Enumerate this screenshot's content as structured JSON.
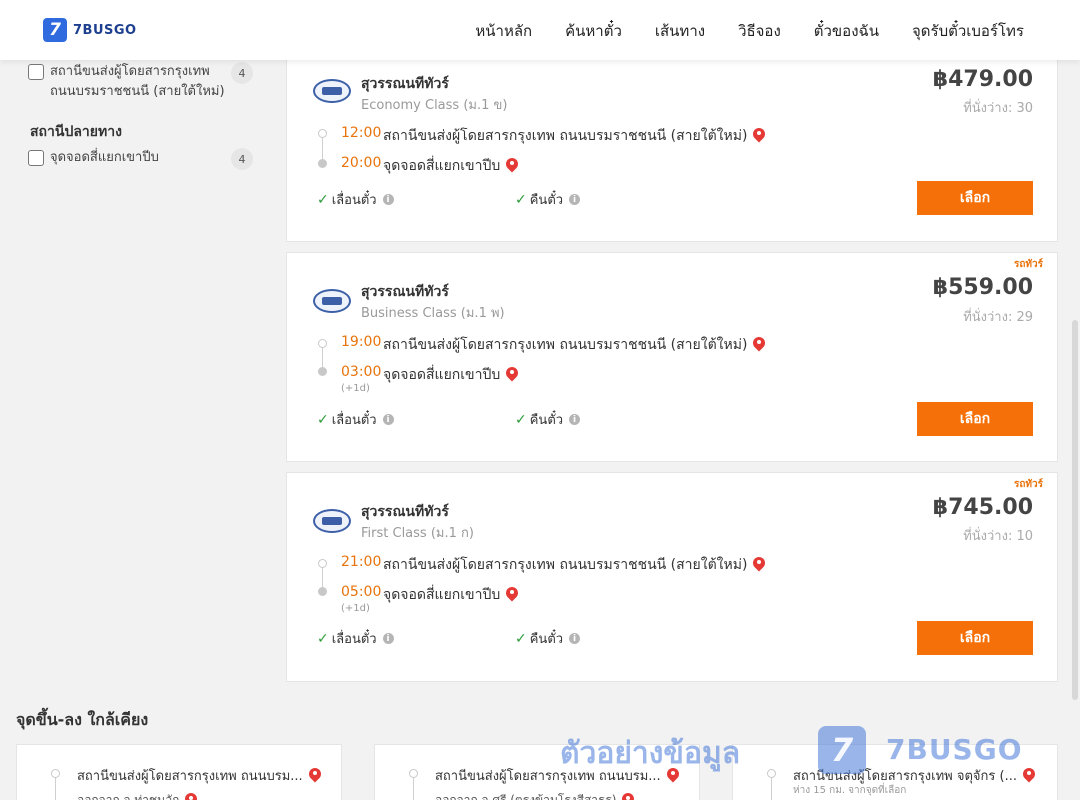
{
  "header": {
    "logo_mark": "7",
    "logo_text": "7BUSGO",
    "nav": [
      "หน้าหลัก",
      "ค้นหาตั๋ว",
      "เส้นทาง",
      "วิธีจอง",
      "ตั๋วของฉัน",
      "จุดรับตั๋วเบอร์โทร"
    ]
  },
  "sidebar": {
    "origin_item": {
      "label": "สถานีขนส่งผู้โดยสารกรุงเทพ ถนนบรมราชชนนี (สายใต้ใหม่)",
      "count": "4"
    },
    "destination_title": "สถานีปลายทาง",
    "destination_item": {
      "label": "จุดจอดสี่แยกเขาปีบ",
      "count": "4"
    }
  },
  "trips": [
    {
      "company": "สุวรรณนทีทัวร์",
      "bus_class": "Economy Class (ม.1 ข)",
      "price": "฿479.00",
      "seats": "ที่นั่งว่าง: 30",
      "tag": "",
      "depart_time": "12:00",
      "depart_station": "สถานีขนส่งผู้โดยสารกรุงเทพ ถนนบรมราชชนนี (สายใต้ใหม่)",
      "arrive_time": "20:00",
      "arrive_station": "จุดจอดสี่แยกเขาปีบ",
      "plus_day": "",
      "feature1": "เลื่อนตั๋ว",
      "feature2": "คืนตั๋ว",
      "button": "เลือก"
    },
    {
      "company": "สุวรรณนทีทัวร์",
      "bus_class": "Business Class (ม.1 พ)",
      "price": "฿559.00",
      "seats": "ที่นั่งว่าง: 29",
      "tag": "รถทัวร์",
      "depart_time": "19:00",
      "depart_station": "สถานีขนส่งผู้โดยสารกรุงเทพ ถนนบรมราชชนนี (สายใต้ใหม่)",
      "arrive_time": "03:00",
      "arrive_station": "จุดจอดสี่แยกเขาปีบ",
      "plus_day": "(+1d)",
      "feature1": "เลื่อนตั๋ว",
      "feature2": "คืนตั๋ว",
      "button": "เลือก"
    },
    {
      "company": "สุวรรณนทีทัวร์",
      "bus_class": "First Class (ม.1 ก)",
      "price": "฿745.00",
      "seats": "ที่นั่งว่าง: 10",
      "tag": "รถทัวร์",
      "depart_time": "21:00",
      "depart_station": "สถานีขนส่งผู้โดยสารกรุงเทพ ถนนบรมราชชนนี (สายใต้ใหม่)",
      "arrive_time": "05:00",
      "arrive_station": "จุดจอดสี่แยกเขาปีบ",
      "plus_day": "(+1d)",
      "feature1": "เลื่อนตั๋ว",
      "feature2": "คืนตั๋ว",
      "button": "เลือก"
    }
  ],
  "nearby": {
    "title": "จุดขึ้น-ลง ใกล้เคียง",
    "cards": [
      {
        "name": "สถานีขนส่งผู้โดยสารกรุงเทพ ถนนบรม...",
        "sub": "ออกจาก จ.ท่าชนวัก"
      },
      {
        "name": "สถานีขนส่งผู้โดยสารกรุงเทพ ถนนบรม...",
        "sub": "ออกจาก จ.ศรี (ตรงข้ามโรงสีสาธร)"
      },
      {
        "name": "สถานีขนส่งผู้โดยสารกรุงเทพ จตุจักร (...",
        "dist": "ห่าง 15 กม. จากจุดที่เลือก"
      }
    ]
  },
  "watermark": {
    "text": "ตัวอย่างข้อมูล",
    "mark": "7",
    "brand": "7BUSGO"
  }
}
